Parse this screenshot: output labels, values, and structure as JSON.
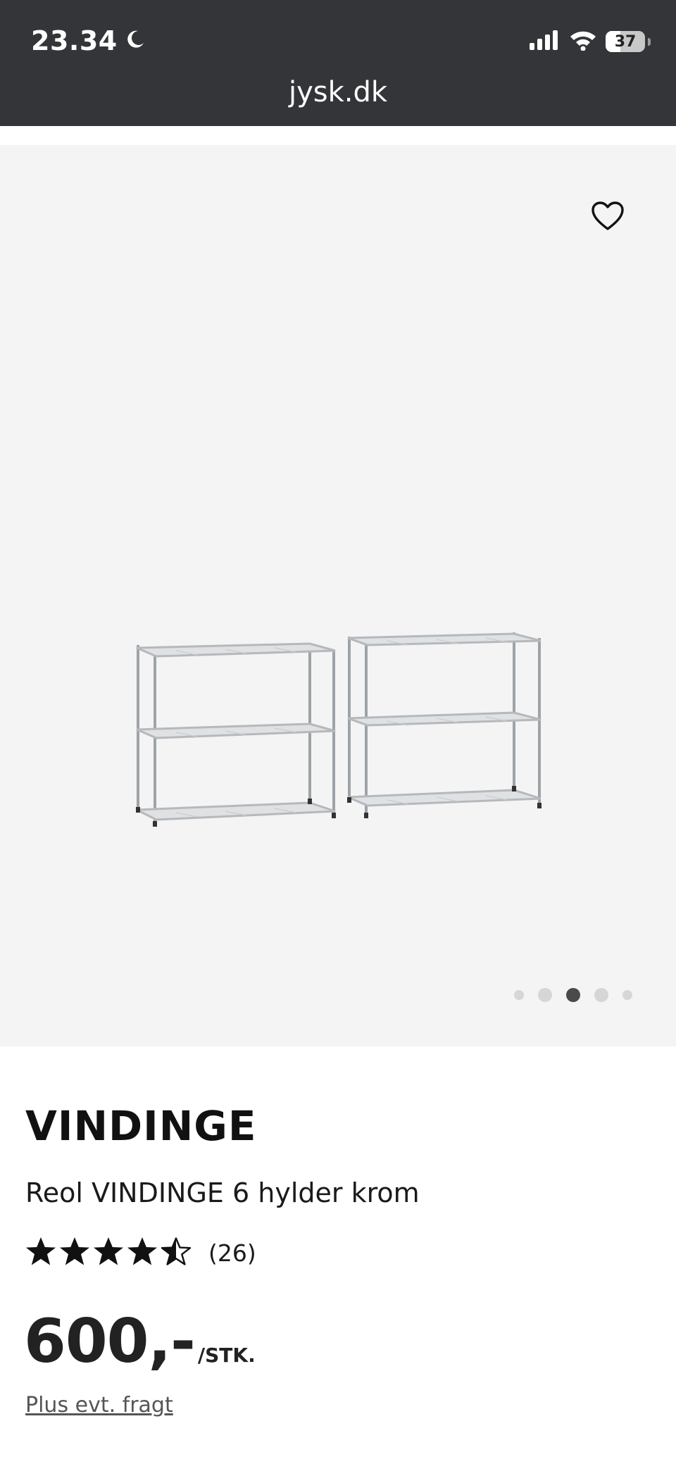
{
  "status_bar": {
    "time": "23.34",
    "battery": "37",
    "icons": [
      "moon-icon",
      "signal-icon",
      "wifi-icon",
      "battery-icon"
    ]
  },
  "browser": {
    "url": "jysk.dk"
  },
  "gallery": {
    "favorite_icon": "heart-outline-icon",
    "image_alt_subject": "chrome-wire-shelving-units",
    "dots_total": 5,
    "active_dot_index": 2
  },
  "product": {
    "brand": "VINDINGE",
    "name": "Reol VINDINGE 6 hylder krom",
    "rating": {
      "stars": 4.5,
      "max": 5,
      "count_label": "(26)"
    },
    "price": "600,-",
    "unit": "/STK.",
    "shipping_label": "Plus evt. fragt"
  },
  "colors": {
    "topbar": "#333538",
    "gallery_bg": "#f4f4f4",
    "text": "#111111",
    "dot_inactive": "#d6d6d6",
    "dot_active": "#4a4a4a"
  }
}
